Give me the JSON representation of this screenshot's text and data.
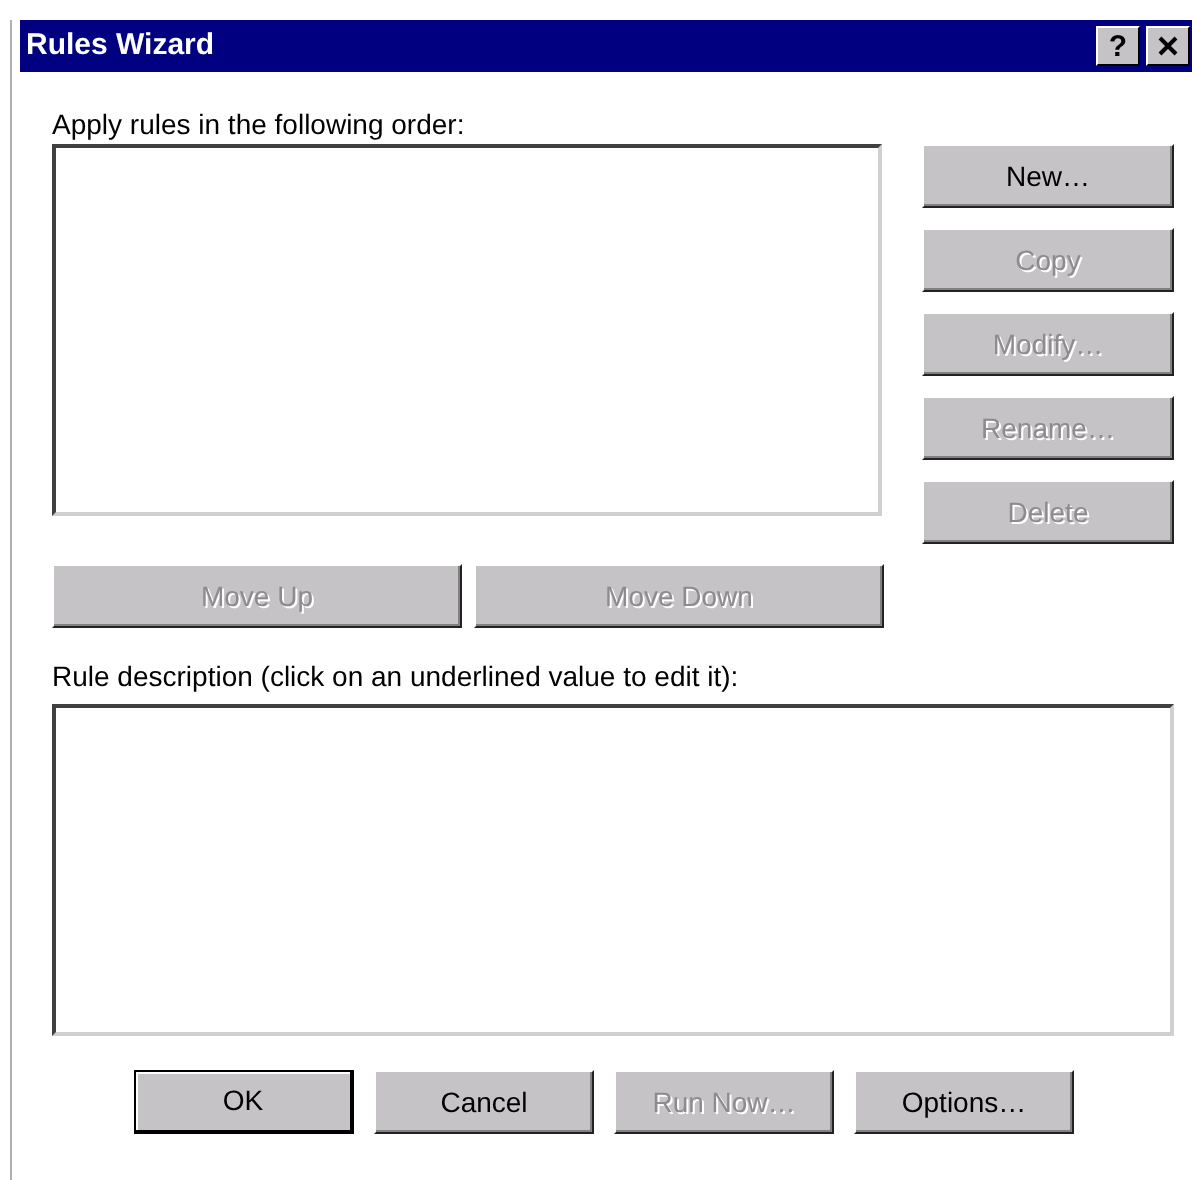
{
  "window": {
    "title": "Rules Wizard",
    "title_buttons": [
      {
        "kind": "help",
        "label": "?"
      },
      {
        "kind": "close"
      }
    ]
  },
  "rules_label": {
    "text": "Apply rules in the following order:"
  },
  "rule_buttons": [
    {
      "label": "New…",
      "disabled": false
    },
    {
      "label": "Copy",
      "disabled": true
    },
    {
      "label": "Modify…",
      "disabled": true
    },
    {
      "label": "Rename…",
      "disabled": true
    },
    {
      "label": "Delete",
      "disabled": true
    }
  ],
  "move_buttons": [
    {
      "label": "Move Up",
      "disabled": true
    },
    {
      "label": "Move Down",
      "disabled": true
    }
  ],
  "description_label": {
    "text": "Rule description (click on an underlined value to edit it):"
  },
  "dialog_buttons": [
    {
      "label": "OK",
      "disabled": false,
      "default": true
    },
    {
      "label": "Cancel",
      "disabled": false,
      "default": false
    },
    {
      "label": "Run Now…",
      "disabled": true,
      "default": false
    },
    {
      "label": "Options…",
      "disabled": false,
      "default": false
    }
  ]
}
